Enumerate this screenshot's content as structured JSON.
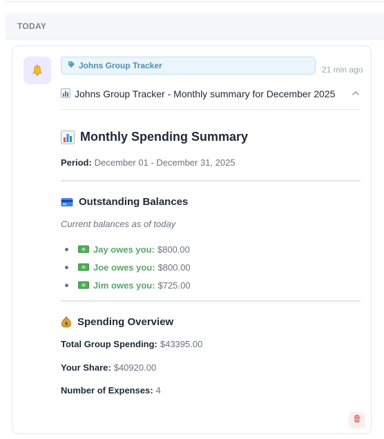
{
  "section": {
    "title": "TODAY"
  },
  "notification": {
    "tag_label": "Johns Group Tracker",
    "time_ago": "21 min ago",
    "subject": "Johns Group Tracker - Monthly summary for December 2025"
  },
  "summary": {
    "title": "Monthly Spending Summary",
    "period_label": "Period:",
    "period_value": "December 01 - December 31, 2025"
  },
  "balances": {
    "title": "Outstanding Balances",
    "subtitle": "Current balances as of today",
    "items": [
      {
        "label": "Jay owes you:",
        "value": "$800.00"
      },
      {
        "label": "Joe owes you:",
        "value": "$800.00"
      },
      {
        "label": "Jim owes you:",
        "value": "$725.00"
      }
    ]
  },
  "overview": {
    "title": "Spending Overview",
    "total_label": "Total Group Spending:",
    "total_value": "$43395.00",
    "share_label": "Your Share:",
    "share_value": "$40920.00",
    "expenses_label": "Number of Expenses:",
    "expenses_value": "4"
  },
  "icons": {
    "notification": "bell-icon",
    "tag": "tag-icon",
    "subject": "bar-chart-icon",
    "collapse": "chevron-up-icon",
    "summary": "bar-chart-icon",
    "balances": "credit-card-icon",
    "balance_item": "money-icon",
    "overview": "money-bag-icon",
    "delete": "trash-icon"
  },
  "colors": {
    "tag_bg": "#eaf6fb",
    "tag_text": "#4a8fb0",
    "balance_green": "#5aa469",
    "bell_bg": "#ede9fe",
    "delete_red": "#e57373"
  }
}
